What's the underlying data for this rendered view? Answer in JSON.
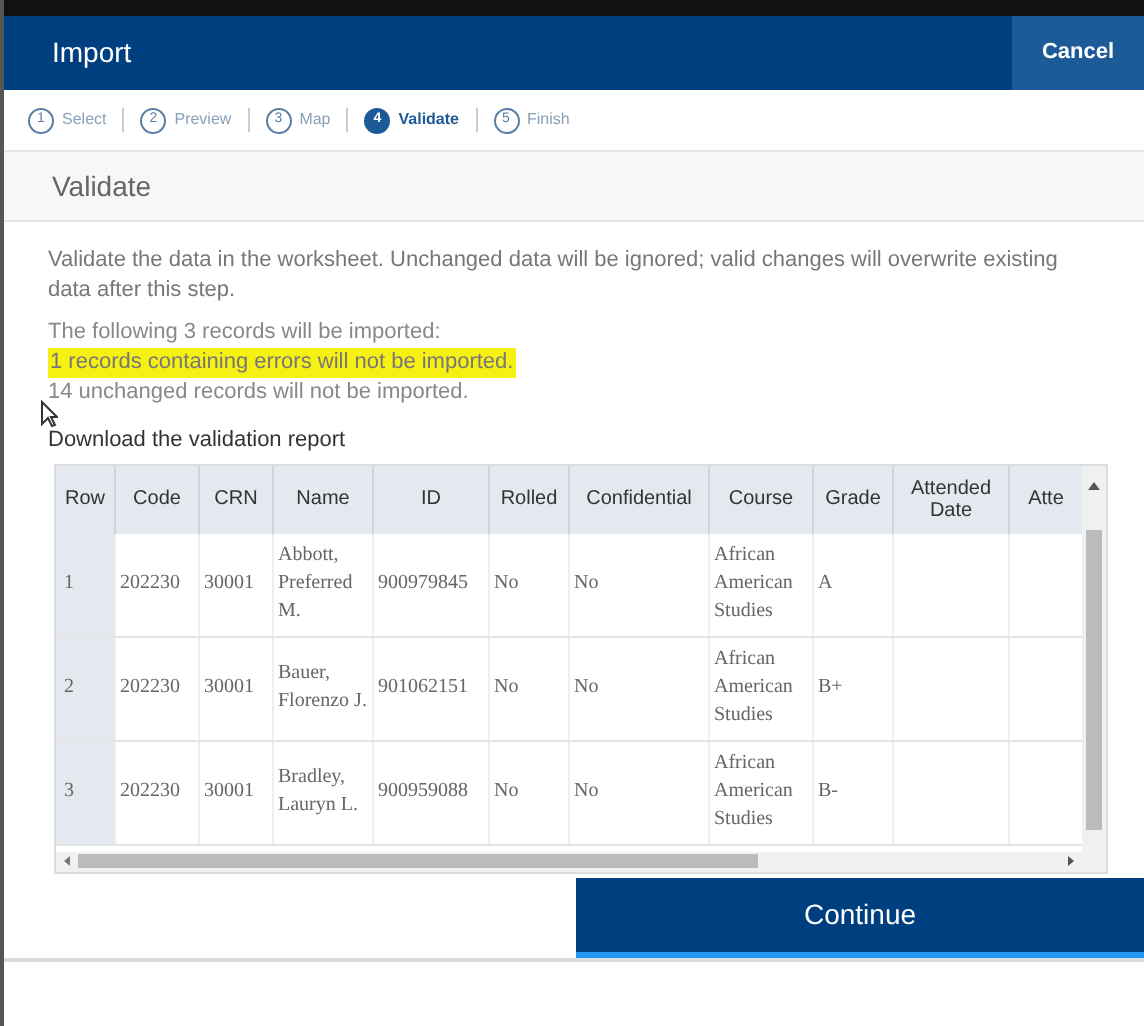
{
  "header": {
    "title": "Import",
    "cancel": "Cancel"
  },
  "steps": [
    {
      "number": "1",
      "label": "Select",
      "selected": false
    },
    {
      "number": "2",
      "label": "Preview",
      "selected": false
    },
    {
      "number": "3",
      "label": "Map",
      "selected": false
    },
    {
      "number": "4",
      "label": "Validate",
      "selected": true
    },
    {
      "number": "5",
      "label": "Finish",
      "selected": false
    }
  ],
  "section_title": "Validate",
  "description": "Validate the data in the worksheet. Unchanged data will be ignored; valid changes will overwrite existing data after this step.",
  "messages": [
    {
      "text": "The following 3 records will be imported:",
      "highlighted": false
    },
    {
      "text": "1 records containing errors will not be imported.",
      "highlighted": true
    },
    {
      "text": "14 unchanged records will not be imported.",
      "highlighted": false
    }
  ],
  "report_link": "Download the validation report",
  "table": {
    "columns": [
      "Row",
      "Code",
      "CRN",
      "Name",
      "ID",
      "Rolled",
      "Confidential",
      "Course",
      "Grade",
      "Attended Date",
      "Atte"
    ],
    "rows": [
      [
        "1",
        "202230",
        "30001",
        "Abbott, Preferred M.",
        "900979845",
        "No",
        "No",
        "African American Studies",
        "A",
        "",
        ""
      ],
      [
        "2",
        "202230",
        "30001",
        "Bauer, Florenzo J.",
        "901062151",
        "No",
        "No",
        "African American Studies",
        "B+",
        "",
        ""
      ],
      [
        "3",
        "202230",
        "30001",
        "Bradley, Lauryn L.",
        "900959088",
        "No",
        "No",
        "African American Studies",
        "B-",
        "",
        ""
      ]
    ]
  },
  "continue": "Continue"
}
